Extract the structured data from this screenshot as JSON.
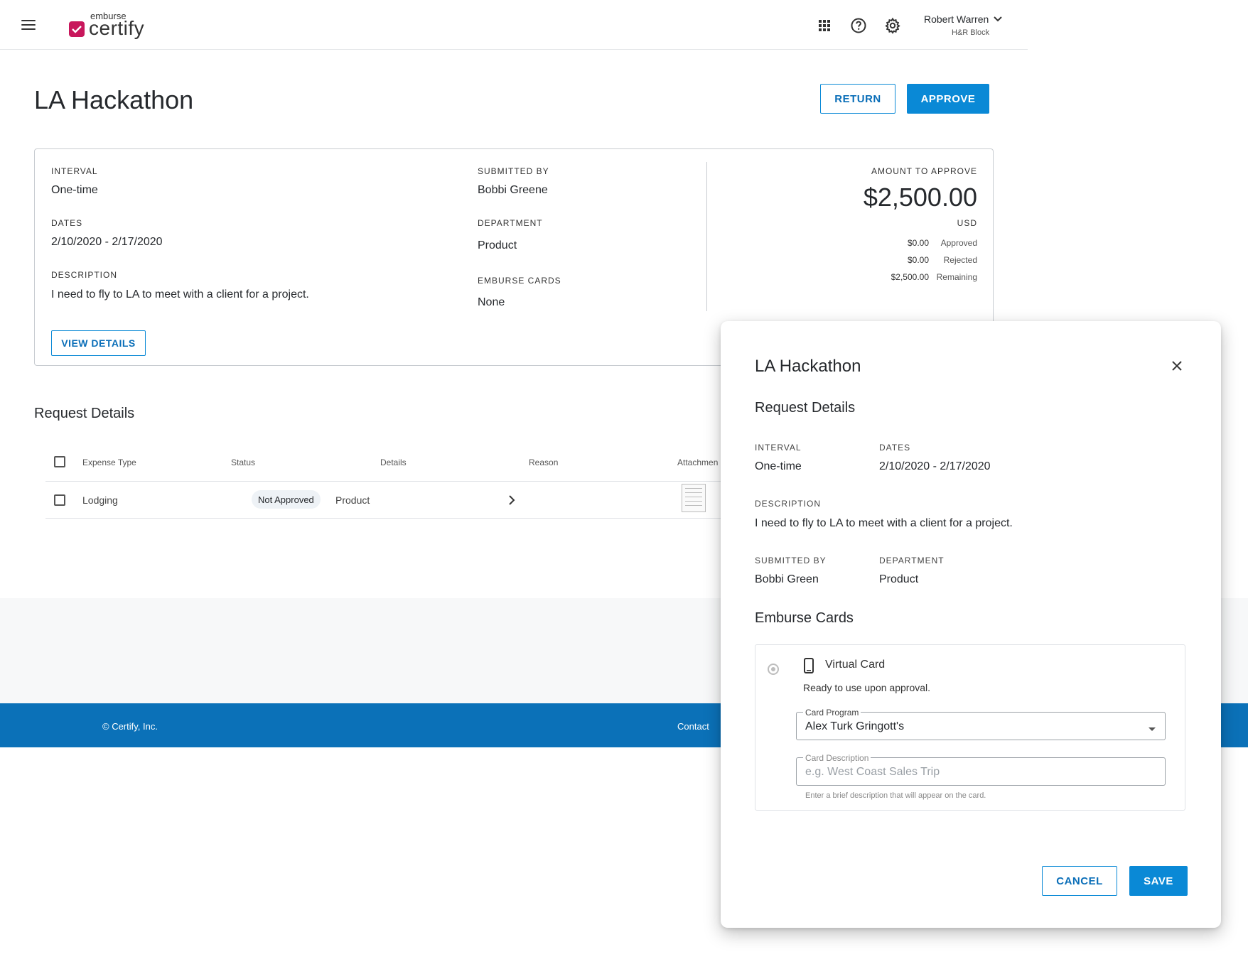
{
  "header": {
    "logo_small": "emburse",
    "logo_big": "certify",
    "user_name": "Robert Warren",
    "user_org": "H&R Block",
    "icons": [
      "menu-icon",
      "apps-grid-icon",
      "help-icon",
      "settings-icon",
      "chevron-down-icon"
    ]
  },
  "page": {
    "title": "LA Hackathon",
    "return_label": "RETURN",
    "approve_label": "APPROVE"
  },
  "summary": {
    "interval_label": "INTERVAL",
    "interval_value": "One-time",
    "dates_label": "DATES",
    "dates_value": "2/10/2020 - 2/17/2020",
    "description_label": "DESCRIPTION",
    "description_value": "I need to fly to LA to meet with a client for a project.",
    "submitted_by_label": "SUBMITTED BY",
    "submitted_by_value": "Bobbi Greene",
    "department_label": "DEPARTMENT",
    "department_value": "Product",
    "emburse_cards_label": "EMBURSE CARDS",
    "emburse_cards_value": "None",
    "view_details_label": "VIEW DETAILS",
    "amount_label": "AMOUNT TO APPROVE",
    "amount_value": "$2,500.00",
    "currency": "USD",
    "breakdown": [
      {
        "amount": "$0.00",
        "label": "Approved"
      },
      {
        "amount": "$0.00",
        "label": "Rejected"
      },
      {
        "amount": "$2,500.00",
        "label": "Remaining"
      }
    ]
  },
  "request_details": {
    "title": "Request Details",
    "columns": [
      "Expense Type",
      "Status",
      "Details",
      "Reason",
      "Attachmen"
    ],
    "rows": [
      {
        "expense_type": "Lodging",
        "status": "Not Approved",
        "details": "Product"
      }
    ]
  },
  "footer": {
    "copyright": "© Certify, Inc.",
    "contact": "Contact"
  },
  "modal": {
    "title": "LA Hackathon",
    "subtitle": "Request Details",
    "interval_label": "INTERVAL",
    "interval_value": "One-time",
    "dates_label": "DATES",
    "dates_value": "2/10/2020 - 2/17/2020",
    "description_label": "DESCRIPTION",
    "description_value": "I need to fly to LA to meet with a client for a project.",
    "submitted_by_label": "SUBMITTED BY",
    "submitted_by_value": "Bobbi Green",
    "department_label": "DEPARTMENT",
    "department_value": "Product",
    "cards_title": "Emburse Cards",
    "virtual_card_label": "Virtual Card",
    "virtual_card_note": "Ready to use upon approval.",
    "card_program_label": "Card Program",
    "card_program_value": "Alex Turk Gringott's",
    "card_description_label": "Card Description",
    "card_description_placeholder": "e.g. West Coast Sales Trip",
    "card_description_helper": "Enter a brief description that will appear on the card.",
    "cancel_label": "CANCEL",
    "save_label": "SAVE"
  },
  "colors": {
    "primary": "#0a89d6",
    "footer": "#0b71b8",
    "brand": "#c8175c"
  }
}
